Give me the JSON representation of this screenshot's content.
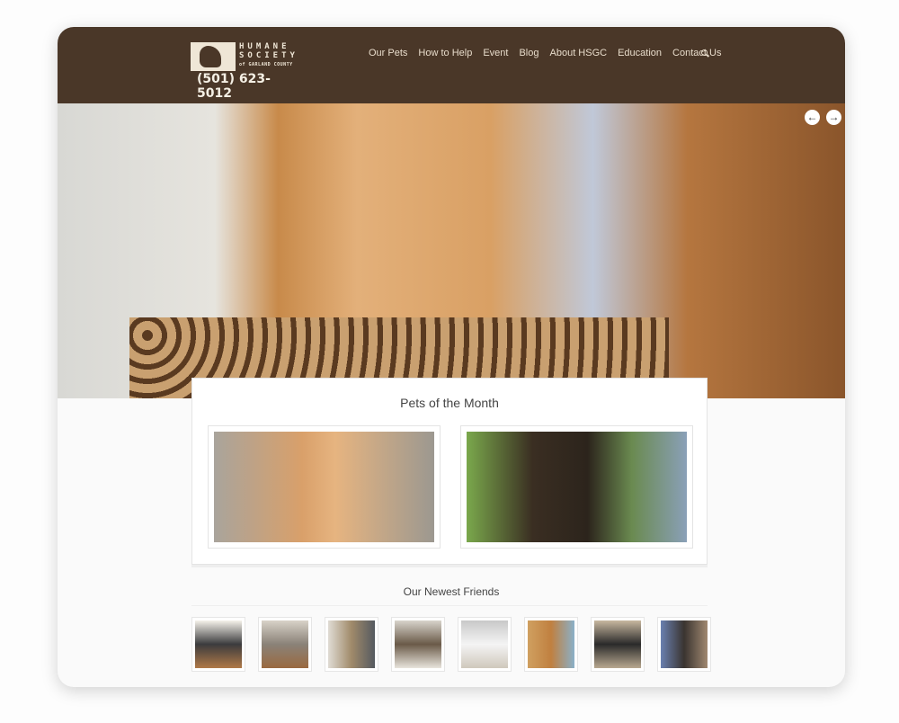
{
  "header": {
    "logo": {
      "line1": "HUMANE",
      "line2": "SOCIETY",
      "line3": "of GARLAND COUNTY"
    },
    "phone": "(501) 623-5012",
    "nav": [
      "Our Pets",
      "How to Help",
      "Event",
      "Blog",
      "About HSGC",
      "Education",
      "Contact Us"
    ],
    "search_icon": "search-icon"
  },
  "hero": {
    "prev_icon": "arrow-left-icon",
    "next_icon": "arrow-right-icon",
    "prev": "←",
    "next": "→"
  },
  "pets_of_month": {
    "title": "Pets of the Month"
  },
  "newest_friends": {
    "title": "Our Newest Friends"
  },
  "colors": {
    "header": "#4a3728",
    "nav_text": "#e8dccb"
  }
}
